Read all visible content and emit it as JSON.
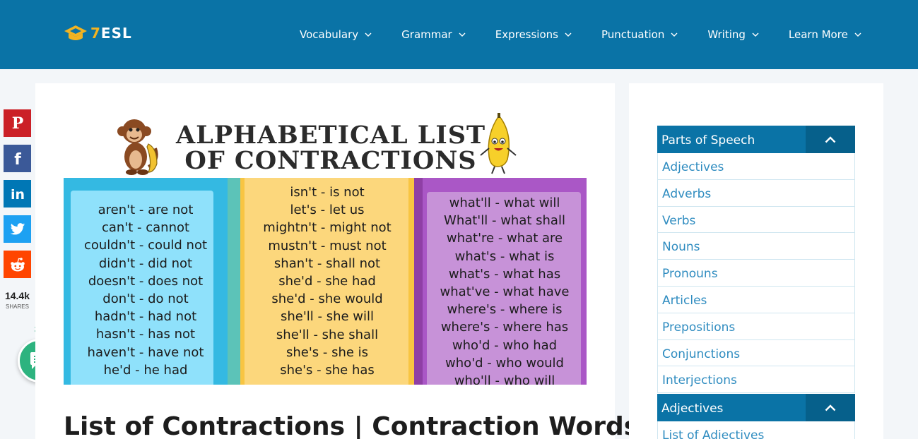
{
  "brand": {
    "logo_seven": "7",
    "logo_text": "ESL"
  },
  "nav": [
    {
      "label": "Vocabulary"
    },
    {
      "label": "Grammar"
    },
    {
      "label": "Expressions"
    },
    {
      "label": "Punctuation"
    },
    {
      "label": "Writing"
    },
    {
      "label": "Learn More"
    }
  ],
  "share": {
    "count": "14.4k",
    "label": "SHARES",
    "comments": "37"
  },
  "hero": {
    "title_line1": "ALPHABETICAL LIST",
    "title_line2": "OF CONTRACTIONS",
    "column1": [
      "aren't - are not",
      "can't - cannot",
      "couldn't - could not",
      "didn't - did not",
      "doesn't - does not",
      "don't - do not",
      "hadn't - had not",
      "hasn't - has not",
      "haven't - have not",
      "he'd - he had"
    ],
    "column2": [
      "isn't - is not",
      "let's - let us",
      "mightn't - might not",
      "mustn't - must not",
      "shan't - shall not",
      "she'd - she had",
      "she'd - she would",
      "she'll - she will",
      "she'll - she shall",
      "she's - she is",
      "she's - she has"
    ],
    "column3": [
      "what'll - what will",
      "What'll - what shall",
      "what're - what are",
      "what's - what is",
      "what's - what has",
      "what've - what have",
      "where's - where is",
      "where's - where has",
      "who'd - who had",
      "who'd - who would",
      "who'll - who will"
    ]
  },
  "article": {
    "title": "List of Contractions | Contraction Words"
  },
  "sidebar": {
    "parts_of_speech": {
      "header": "Parts of Speech",
      "items": [
        "Adjectives",
        "Adverbs",
        "Verbs",
        "Nouns",
        "Pronouns",
        "Articles",
        "Prepositions",
        "Conjunctions",
        "Interjections"
      ]
    },
    "adjectives": {
      "header": "Adjectives",
      "items": [
        "List of Adjectives"
      ]
    }
  },
  "colors": {
    "header": "#0a73a6",
    "accent": "#f2b321",
    "link": "#2f8cc0",
    "comment": "#2db37f"
  }
}
